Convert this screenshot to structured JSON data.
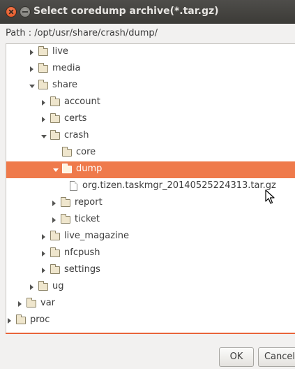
{
  "window": {
    "title": "Select coredump archive(*.tar.gz)"
  },
  "path": {
    "text": "Path : /opt/usr/share/crash/dump/"
  },
  "tree": {
    "items": [
      {
        "label": "live",
        "icon": "folder-icon",
        "expander": "collapsed"
      },
      {
        "label": "media",
        "icon": "folder-icon",
        "expander": "collapsed"
      },
      {
        "label": "share",
        "icon": "folder-icon",
        "expander": "expanded"
      },
      {
        "label": "account",
        "icon": "folder-icon",
        "expander": "collapsed"
      },
      {
        "label": "certs",
        "icon": "folder-icon",
        "expander": "collapsed"
      },
      {
        "label": "crash",
        "icon": "folder-icon",
        "expander": "expanded"
      },
      {
        "label": "core",
        "icon": "folder-icon",
        "expander": "none"
      },
      {
        "label": "dump",
        "icon": "folder-icon",
        "expander": "expanded",
        "selected": true
      },
      {
        "label": "org.tizen.taskmgr_20140525224313.tar.gz",
        "icon": "file-icon",
        "expander": "none"
      },
      {
        "label": "report",
        "icon": "folder-icon",
        "expander": "collapsed"
      },
      {
        "label": "ticket",
        "icon": "folder-icon",
        "expander": "collapsed"
      },
      {
        "label": "live_magazine",
        "icon": "folder-icon",
        "expander": "collapsed"
      },
      {
        "label": "nfcpush",
        "icon": "folder-icon",
        "expander": "collapsed"
      },
      {
        "label": "settings",
        "icon": "folder-icon",
        "expander": "collapsed"
      },
      {
        "label": "ug",
        "icon": "folder-icon",
        "expander": "collapsed"
      },
      {
        "label": "var",
        "icon": "folder-icon",
        "expander": "collapsed"
      },
      {
        "label": "proc",
        "icon": "folder-icon",
        "expander": "collapsed"
      }
    ]
  },
  "buttons": {
    "ok_label": "OK",
    "cancel_label": "Cancel"
  },
  "colors": {
    "selection": "#ef7a4b",
    "titlebar": "#3c3b37",
    "close_button": "#df4a16"
  }
}
